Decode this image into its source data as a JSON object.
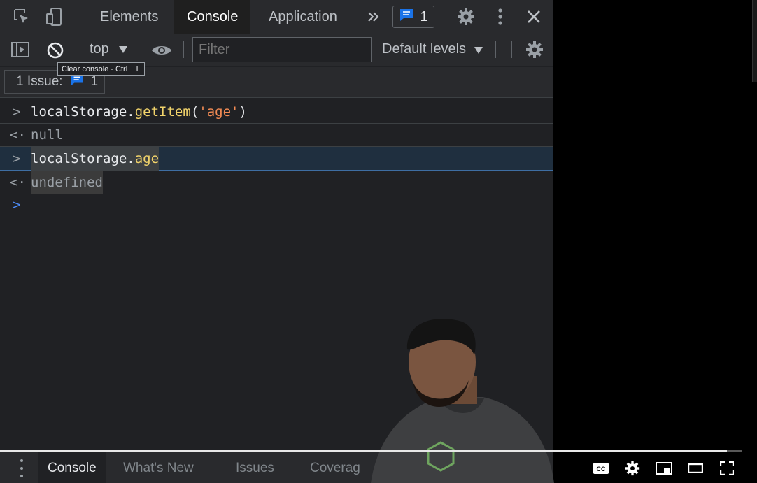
{
  "devtools": {
    "tabs": [
      {
        "label": "Elements",
        "active": false
      },
      {
        "label": "Console",
        "active": true
      },
      {
        "label": "Application",
        "active": false
      }
    ],
    "more_tabs_icon": ">>",
    "issues_badge_count": "1",
    "toolbar": {
      "context": "top",
      "filter_placeholder": "Filter",
      "levels": "Default levels",
      "tooltip": "Clear console - Ctrl + L"
    },
    "issues_bar": {
      "label": "1 Issue:",
      "count": "1"
    }
  },
  "console": {
    "entries": [
      {
        "type": "input",
        "marker": ">",
        "object": "localStorage",
        "dot": ".",
        "method": "getItem",
        "open": "(",
        "arg": "'age'",
        "close": ")"
      },
      {
        "type": "output",
        "marker": "<·",
        "value": "null"
      },
      {
        "type": "input",
        "marker": ">",
        "object": "localStorage",
        "dot": ".",
        "prop": "age"
      },
      {
        "type": "output",
        "marker": "<·",
        "value": "undefined"
      }
    ],
    "prompt": ">"
  },
  "drawer": {
    "tabs": [
      {
        "label": "Console",
        "active": true
      },
      {
        "label": "What's New",
        "active": false
      },
      {
        "label": "Issues",
        "active": false
      },
      {
        "label": "Coverag",
        "active": false
      }
    ]
  },
  "player": {
    "progress": 0.98,
    "controls": [
      "captions-icon",
      "settings-icon",
      "miniplayer-icon",
      "theater-icon",
      "fullscreen-icon"
    ]
  },
  "colors": {
    "panel_bg": "#202124",
    "toolbar_bg": "#292a2d",
    "method": "#f2d46b",
    "string": "#f28b54",
    "accent": "#4d8bf5"
  }
}
